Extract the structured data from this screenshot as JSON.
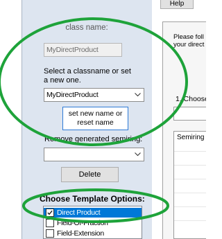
{
  "header": {
    "help_label": "Help"
  },
  "left_panel": {
    "class_name_title": "class name:",
    "class_name_value": "MyDirectProduct",
    "select_hint": "Select a classname or set a new one.",
    "classname_combo_value": "MyDirectProduct",
    "set_new_name_button": "set new name or reset name",
    "remove_label": "Remove generated semiring:",
    "remove_combo_value": "",
    "delete_button": "Delete",
    "template_title": "Choose Template Options:",
    "template_options": [
      {
        "label": "Direct Product",
        "checked": true,
        "selected": true
      },
      {
        "label": "Field-Of-Fraction",
        "checked": false,
        "selected": false
      },
      {
        "label": "Field-Extension",
        "checked": false,
        "selected": false
      }
    ]
  },
  "right_panel": {
    "instructions_line1": "Please foll",
    "instructions_line2": "your direct",
    "step_label": "1. Choose",
    "list_header": "Semiring"
  },
  "colors": {
    "annotation": "#1ea33a",
    "panel_bg": "#dde5f0",
    "selection": "#0078d7",
    "button_border": "#2d7ad6"
  },
  "icons": [
    "chevron-down-icon",
    "checkmark-icon"
  ]
}
